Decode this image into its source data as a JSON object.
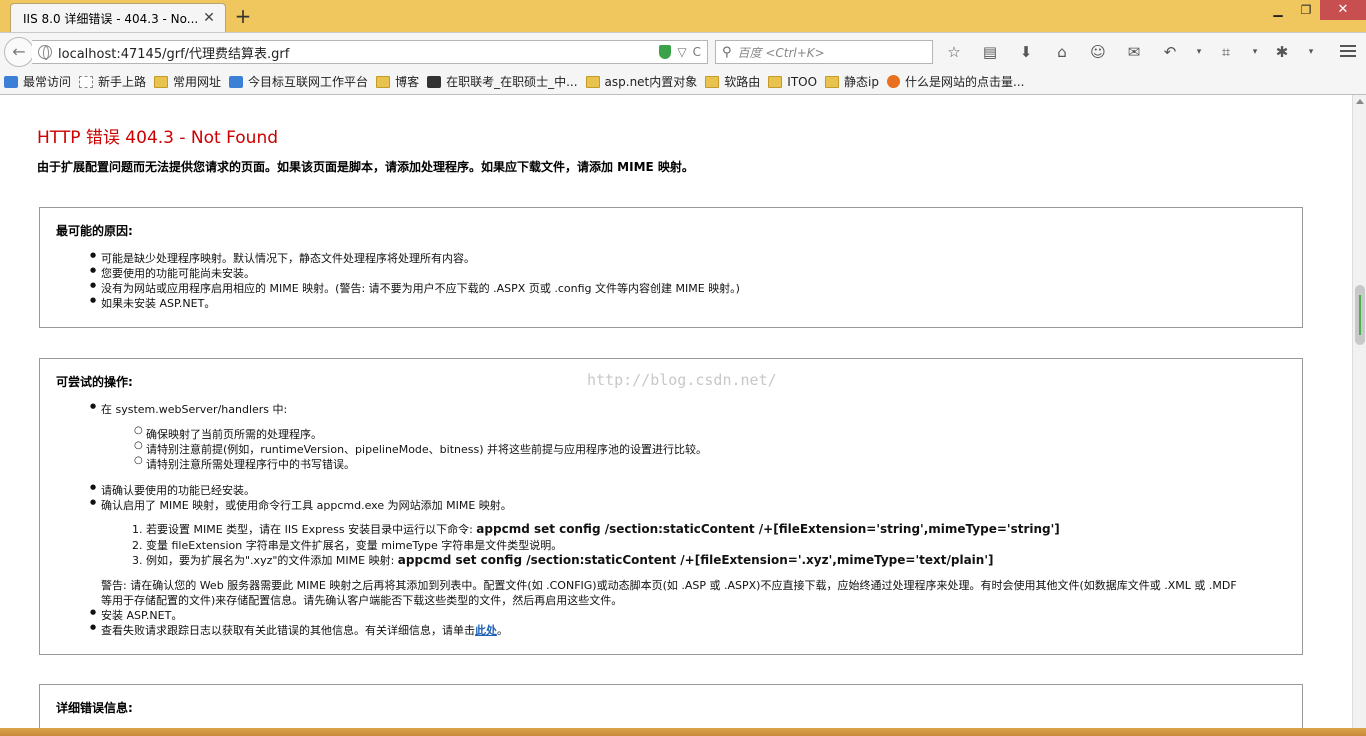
{
  "browser": {
    "tab_title": "IIS 8.0 详细错误 - 404.3 - No...",
    "tab_close": "✕",
    "new_tab": "+",
    "win_minimize": "▁",
    "win_restore": "❐",
    "win_close": "✕",
    "url": "localhost:47145/grf/代理费结算表.grf",
    "search_placeholder": "百度 <Ctrl+K>",
    "back_glyph": "←",
    "reload_glyph": "C",
    "dropdown_glyph": "▽"
  },
  "bookmarks": [
    {
      "label": "最常访问",
      "icon": "blue"
    },
    {
      "label": "新手上路",
      "icon": "page"
    },
    {
      "label": "常用网址",
      "icon": "folder"
    },
    {
      "label": "今目标互联网工作平台",
      "icon": "blue"
    },
    {
      "label": "博客",
      "icon": "folder"
    },
    {
      "label": "在职联考_在职硕士_中...",
      "icon": "cap"
    },
    {
      "label": "asp.net内置对象",
      "icon": "folder"
    },
    {
      "label": "软路由",
      "icon": "folder"
    },
    {
      "label": "ITOO",
      "icon": "folder"
    },
    {
      "label": "静态ip",
      "icon": "folder"
    },
    {
      "label": "什么是网站的点击量...",
      "icon": "ff"
    }
  ],
  "page": {
    "title": "HTTP 错误 404.3 - Not Found",
    "subtitle": "由于扩展配置问题而无法提供您请求的页面。如果该页面是脚本，请添加处理程序。如果应下载文件，请添加 MIME 映射。",
    "watermark": "http://blog.csdn.net/",
    "causes": {
      "heading": "最可能的原因:",
      "items": [
        "可能是缺少处理程序映射。默认情况下，静态文件处理程序将处理所有内容。",
        "您要使用的功能可能尚未安装。",
        "没有为网站或应用程序启用相应的 MIME 映射。(警告: 请不要为用户不应下载的 .ASPX 页或 .config 文件等内容创建 MIME 映射。)",
        "如果未安装 ASP.NET。"
      ]
    },
    "actions": {
      "heading": "可尝试的操作:",
      "item1": "在 system.webServer/handlers 中:",
      "sub": [
        "确保映射了当前页所需的处理程序。",
        "请特别注意前提(例如，runtimeVersion、pipelineMode、bitness) 并将这些前提与应用程序池的设置进行比较。",
        "请特别注意所需处理程序行中的书写错误。"
      ],
      "item2": "请确认要使用的功能已经安装。",
      "item3": "确认启用了 MIME 映射，或使用命令行工具 appcmd.exe 为网站添加 MIME 映射。",
      "steps": [
        {
          "num": "1.",
          "text": "若要设置 MIME 类型，请在 IIS Express 安装目录中运行以下命令:",
          "code": "appcmd set config /section:staticContent /+[fileExtension='string',mimeType='string']"
        },
        {
          "num": "2.",
          "text": "变量 fileExtension 字符串是文件扩展名，变量 mimeType 字符串是文件类型说明。",
          "code": ""
        },
        {
          "num": "3.",
          "text": "例如，要为扩展名为\".xyz\"的文件添加 MIME 映射:",
          "code": "appcmd set config /section:staticContent /+[fileExtension='.xyz',mimeType='text/plain']"
        }
      ],
      "warning_line1": "警告: 请在确认您的 Web 服务器需要此 MIME 映射之后再将其添加到列表中。配置文件(如 .CONFIG)或动态脚本页(如 .ASP 或 .ASPX)不应直接下载，应始终通过处理程序来处理。有时会使用其他文件(如数据库文件或 .XML 或 .MDF",
      "warning_line2": "等用于存储配置的文件)来存储配置信息。请先确认客户端能否下载这些类型的文件，然后再启用这些文件。",
      "item4": "安装 ASP.NET。",
      "item5": "查看失败请求跟踪日志以获取有关此错误的其他信息。有关详细信息，请单击",
      "item5_link": "此处",
      "item5_end": "。"
    },
    "detail": {
      "heading": "详细错误信息:"
    }
  }
}
